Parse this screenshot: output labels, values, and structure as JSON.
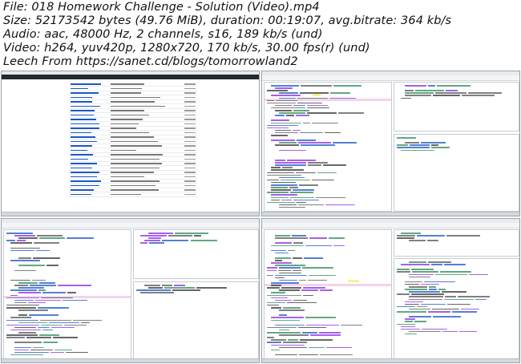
{
  "media_info": {
    "file": "File: 018 Homework Challenge - Solution (Video).mp4",
    "size": "Size: 52173542 bytes (49.76 MiB), duration: 00:19:07, avg.bitrate: 364 kb/s",
    "audio": "Audio: aac, 48000 Hz, 2 channels, s16, 189 kb/s (und)",
    "video": "Video: h264, yuv420p, 1280x720, 170 kb/s, 30.00 fps(r) (und)",
    "leech": "Leech From https://sanet.cd/blogs/tomorrowland2"
  },
  "thumbnails": [
    {
      "kind": "browser-github",
      "label": "GitHub repository file list"
    },
    {
      "kind": "ide",
      "label": "Spyder editor with console"
    },
    {
      "kind": "ide",
      "label": "Spyder editor with file explorer"
    },
    {
      "kind": "ide",
      "label": "Spyder editor with console and code"
    }
  ],
  "colors": {
    "accent_blue": "#1a56c4",
    "keyword_purple": "#8a2be2",
    "string_green": "#2e8b57",
    "highlight_yellow": "#f7f38b",
    "highlight_pink": "#f3d4ea",
    "github_dark": "#24292e"
  }
}
